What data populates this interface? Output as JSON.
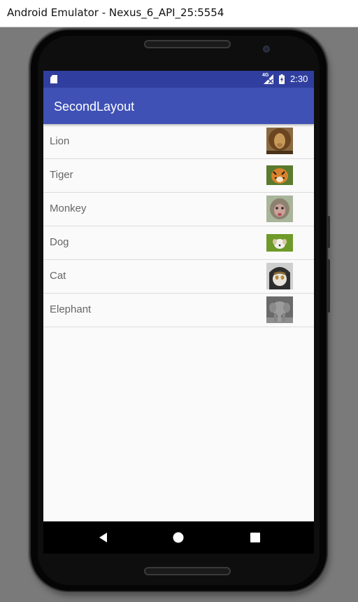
{
  "window": {
    "title": "Android Emulator - Nexus_6_API_25:5554"
  },
  "status_bar": {
    "network": "4G",
    "time": "2:30",
    "background": "#303f9f"
  },
  "app_bar": {
    "title": "SecondLayout",
    "background": "#3f51b5"
  },
  "animals": [
    {
      "label": "Lion",
      "icon": "lion-photo"
    },
    {
      "label": "Tiger",
      "icon": "tiger-photo"
    },
    {
      "label": "Monkey",
      "icon": "monkey-photo"
    },
    {
      "label": "Dog",
      "icon": "dog-photo"
    },
    {
      "label": "Cat",
      "icon": "cat-photo"
    },
    {
      "label": "Elephant",
      "icon": "elephant-photo"
    }
  ],
  "nav_bar": {
    "back": "back-icon",
    "home": "home-icon",
    "recents": "recents-icon"
  }
}
